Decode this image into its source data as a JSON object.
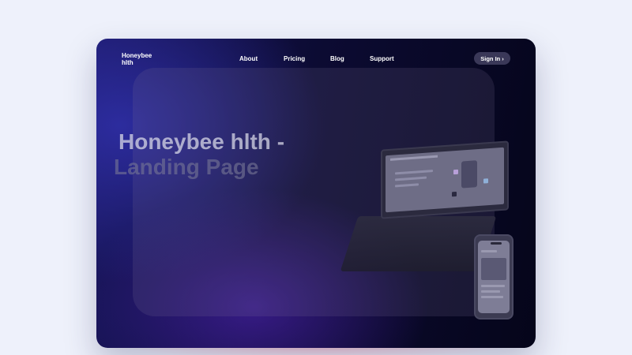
{
  "brand": {
    "logo_line1": "Honeybee",
    "logo_line2": "hlth"
  },
  "nav": {
    "links": [
      "About",
      "Pricing",
      "Blog",
      "Support"
    ],
    "signin_label": "Sign In",
    "signin_arrow": "›"
  },
  "hero": {
    "title_line1": "Honeybee hlth -",
    "title_line2": "Landing Page"
  },
  "colors": {
    "page_background": "#eef1fb",
    "window_dark": "#05051a",
    "window_blue": "#1a1760",
    "signin_pill": "#3a3858"
  },
  "icons": [
    "laptop-mockup-icon",
    "phone-mockup-icon"
  ]
}
